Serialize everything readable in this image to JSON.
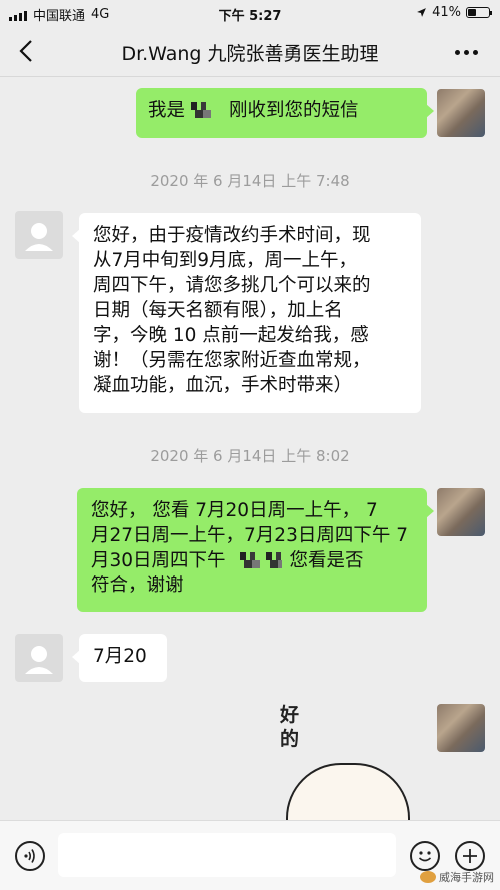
{
  "status_bar": {
    "carrier": "中国联通",
    "network": "4G",
    "time": "下午 5:27",
    "battery": "41%",
    "battery_level": 0.41
  },
  "nav": {
    "title": "Dr.Wang 九院张善勇医生助理"
  },
  "messages": [
    {
      "side": "right",
      "text_before": "我是",
      "text_after": "刚收到您的短信"
    },
    {
      "timestamp": "2020 年 6 月14日 上午 7:48"
    },
    {
      "side": "left",
      "lines": [
        "您好，由于疫情改约手术时间，现",
        "从7月中旬到9月底，周一上午，",
        "周四下午，请您多挑几个可以来的",
        "日期（每天名额有限），加上名",
        "字，今晚 10 点前一起发给我，感",
        "谢！（另需在您家附近查血常规，",
        "凝血功能，血沉，手术时带来）"
      ]
    },
    {
      "timestamp": "2020 年 6 月14日 上午 8:02"
    },
    {
      "side": "right",
      "lines": [
        "您好，  您看 7月20日周一上午，  7",
        "月27日周一上午，7月23日周四下午 7",
        "月30日周四下午"
      ],
      "line3_after": "您看是否",
      "line4": "符合，谢谢"
    },
    {
      "side": "left",
      "text": "7月20"
    },
    {
      "side": "right",
      "sticker_text": [
        "好",
        "的"
      ]
    }
  ],
  "watermark": "威海手游网",
  "icons": {
    "back": "chevron-left-icon",
    "more": "more-dots-icon",
    "voice": "voice-icon",
    "emoji": "emoji-icon",
    "add": "add-icon",
    "default_avatar": "person-icon"
  }
}
